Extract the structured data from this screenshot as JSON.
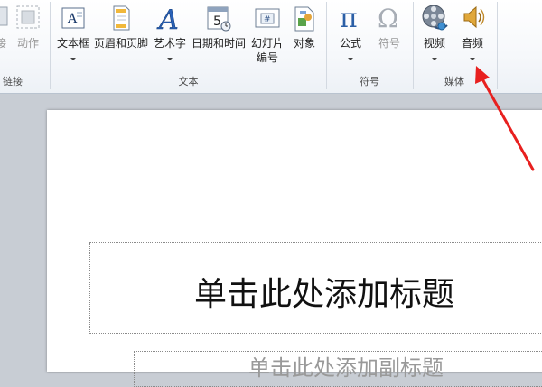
{
  "ribbon": {
    "left_partial": {
      "label1": "接",
      "label2": "动作",
      "group": "链接"
    },
    "text_group": {
      "label": "文本",
      "buttons": [
        {
          "label": "文本框"
        },
        {
          "label": "页眉和页脚"
        },
        {
          "label": "艺术字"
        },
        {
          "label": "日期和时间"
        },
        {
          "label": "幻灯片",
          "label2": "编号"
        },
        {
          "label": "对象"
        }
      ]
    },
    "symbol_group": {
      "label": "符号",
      "buttons": [
        {
          "label": "公式"
        },
        {
          "label": "符号"
        }
      ]
    },
    "media_group": {
      "label": "媒体",
      "buttons": [
        {
          "label": "视频"
        },
        {
          "label": "音频"
        }
      ]
    }
  },
  "slide": {
    "title_placeholder": "单击此处添加标题",
    "subtitle_placeholder": "单击此处添加副标题"
  },
  "annotation": {
    "arrow_color": "#e8201f"
  }
}
